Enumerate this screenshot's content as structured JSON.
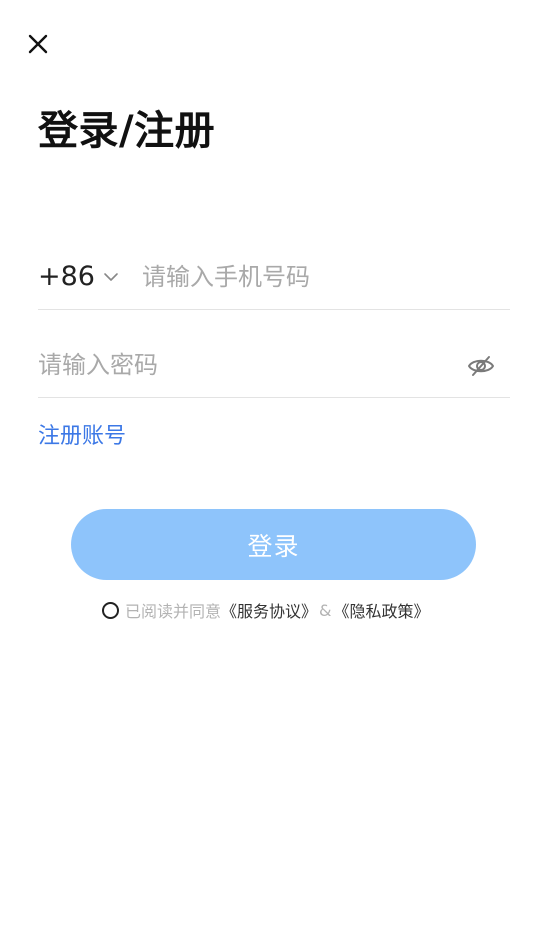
{
  "header": {
    "close_icon": "close-icon",
    "title": "登录/注册"
  },
  "phone": {
    "country_code": "+86",
    "dropdown_icon": "chevron-down-icon",
    "placeholder": "请输入手机号码",
    "value": ""
  },
  "password": {
    "placeholder": "请输入密码",
    "value": "",
    "visibility_icon": "eye-hidden-icon"
  },
  "register": {
    "label": "注册账号"
  },
  "login": {
    "label": "登录"
  },
  "agreement": {
    "checked": false,
    "prefix": "已阅读并同意",
    "service_link": "《服务协议》",
    "amp": "&",
    "privacy_link": "《隐私政策》"
  },
  "colors": {
    "link_blue": "#3c78e6",
    "button_disabled_blue": "#8ec4fb",
    "placeholder_gray": "#a9a9a9",
    "divider": "#e3e3e3"
  }
}
